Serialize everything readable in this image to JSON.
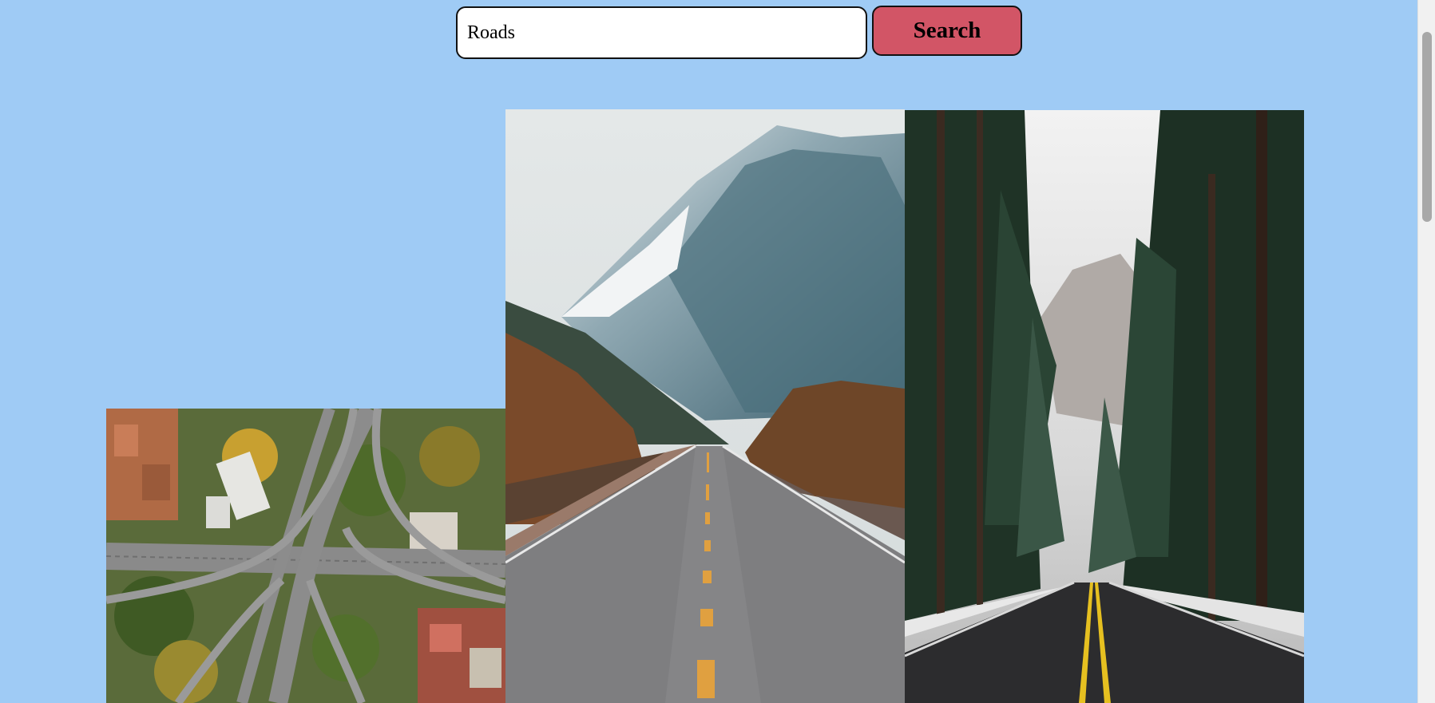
{
  "search": {
    "value": "Roads",
    "button_label": "Search"
  },
  "photos": [
    {
      "name": "aerial-interchange",
      "description_icon": "image-icon"
    },
    {
      "name": "mountain-road",
      "description_icon": "image-icon"
    },
    {
      "name": "forest-road",
      "description_icon": "image-icon"
    }
  ],
  "colors": {
    "background": "#9fcbf5",
    "search_button": "#d25566"
  },
  "scrollbar": {
    "position_fraction": 0.05
  }
}
